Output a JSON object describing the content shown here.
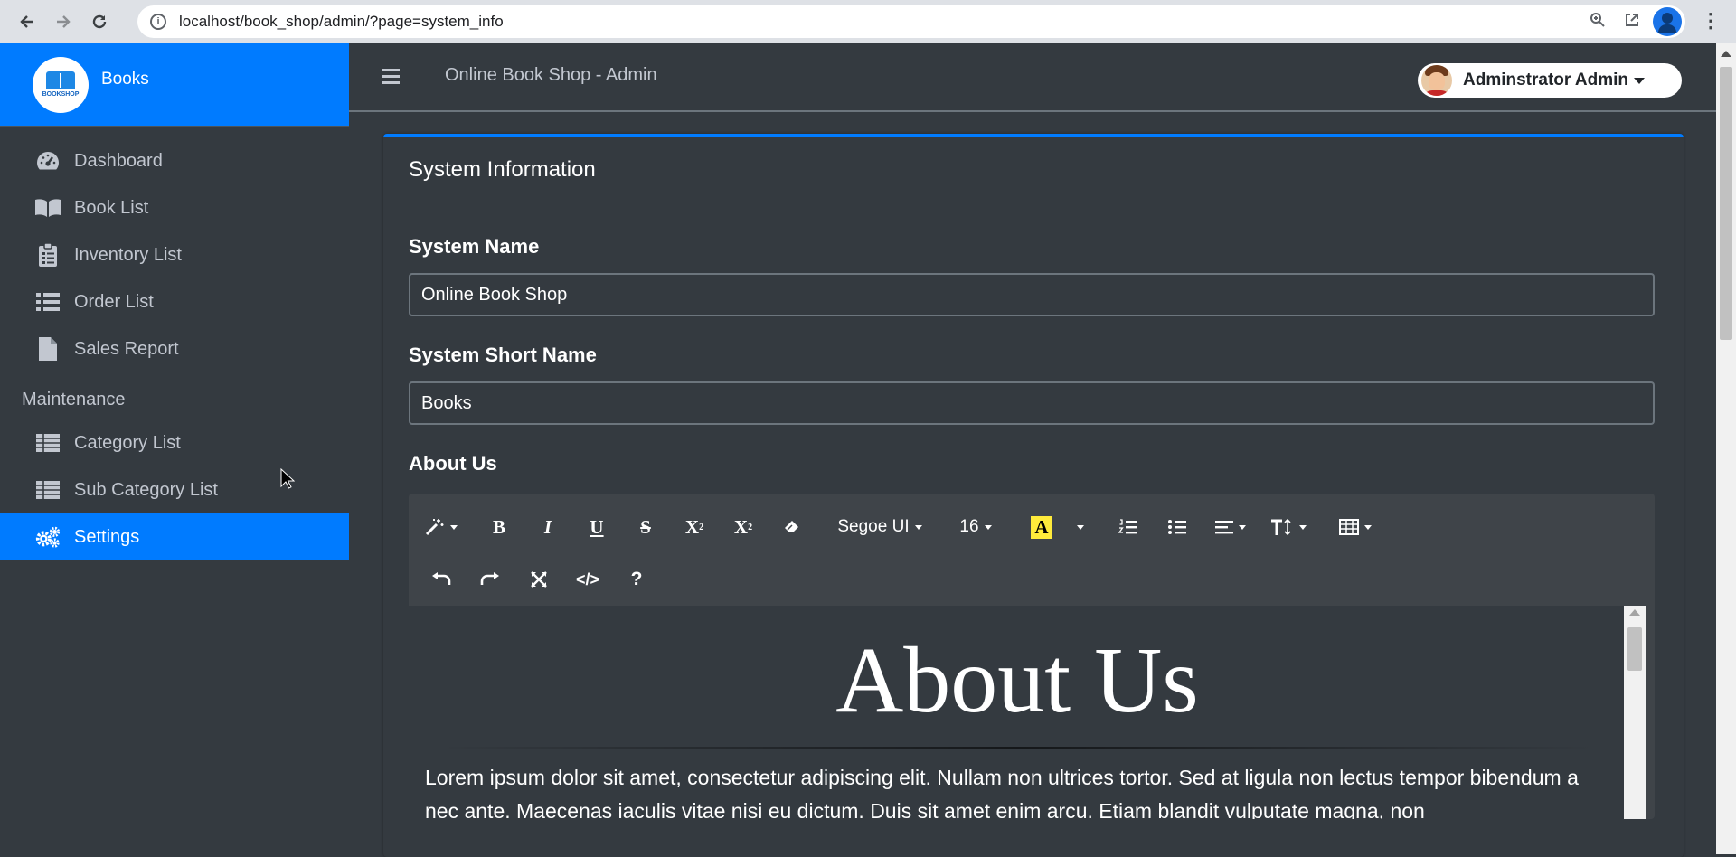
{
  "browser": {
    "url": "localhost/book_shop/admin/?page=system_info"
  },
  "sidebar": {
    "brand_name": "Books",
    "brand_logo_text": "BOOKSHOP",
    "items": [
      {
        "label": "Dashboard",
        "icon": "tachometer-icon"
      },
      {
        "label": "Book List",
        "icon": "book-open-icon"
      },
      {
        "label": "Inventory List",
        "icon": "clipboard-list-icon"
      },
      {
        "label": "Order List",
        "icon": "list-icon"
      },
      {
        "label": "Sales Report",
        "icon": "file-icon"
      }
    ],
    "section_header": "Maintenance",
    "maintenance_items": [
      {
        "label": "Category List",
        "icon": "table-icon"
      },
      {
        "label": "Sub Category List",
        "icon": "table-icon"
      },
      {
        "label": "Settings",
        "icon": "cogs-icon",
        "active": true
      }
    ],
    "active_color": "#007bff"
  },
  "topbar": {
    "title": "Online Book Shop - Admin",
    "user_name": "Adminstrator Admin"
  },
  "card": {
    "title": "System Information",
    "fields": {
      "system_name_label": "System Name",
      "system_name_value": "Online Book Shop",
      "system_short_name_label": "System Short Name",
      "system_short_name_value": "Books",
      "about_label": "About Us"
    }
  },
  "editor": {
    "font_family": "Segoe UI",
    "font_size": "16",
    "content_heading": "About Us",
    "content_paragraph": "Lorem ipsum dolor sit amet, consectetur adipiscing elit. Nullam non ultrices tortor. Sed at ligula non lectus tempor bibendum a nec ante. Maecenas iaculis vitae nisi eu dictum. Duis sit amet enim arcu. Etiam blandit vulputate magna, non"
  }
}
